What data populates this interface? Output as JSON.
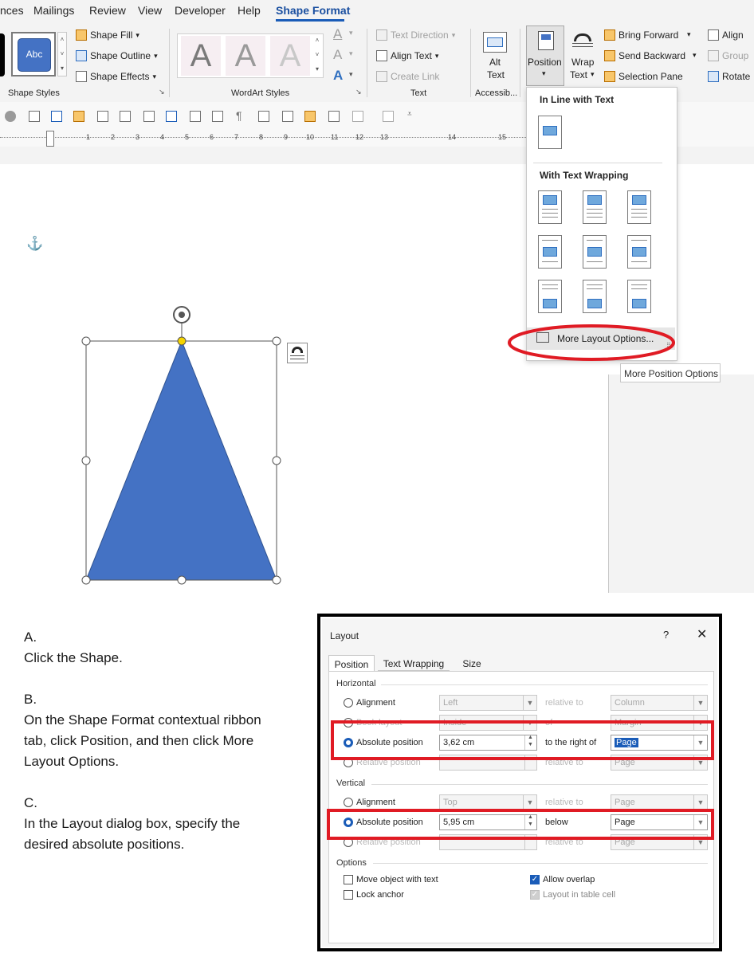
{
  "menu": {
    "items": [
      "nces",
      "Mailings",
      "Review",
      "View",
      "Developer",
      "Help",
      "Shape Format"
    ]
  },
  "ribbon": {
    "shape_styles": {
      "sample_label": "Abc",
      "shape_fill": "Shape Fill",
      "shape_outline": "Shape Outline",
      "shape_effects": "Shape Effects",
      "group_label": "Shape Styles"
    },
    "wordart": {
      "letter": "A",
      "group_label": "WordArt Styles"
    },
    "text": {
      "text_direction": "Text Direction",
      "align_text": "Align Text",
      "create_link": "Create Link",
      "group_label": "Text"
    },
    "accessibility": {
      "alt_text_line1": "Alt",
      "alt_text_line2": "Text",
      "group_label": "Accessib..."
    },
    "arrange": {
      "position": "Position",
      "wrap_line1": "Wrap",
      "wrap_line2": "Text",
      "bring_forward": "Bring Forward",
      "send_backward": "Send Backward",
      "selection_pane": "Selection Pane",
      "align": "Align",
      "group": "Group",
      "rotate": "Rotate"
    }
  },
  "ruler": {
    "numbers": [
      "1",
      "2",
      "3",
      "4",
      "5",
      "6",
      "7",
      "8",
      "9",
      "10",
      "11",
      "12",
      "13",
      "14",
      "15"
    ]
  },
  "position_menu": {
    "inline_heading": "In Line with Text",
    "wrapping_heading": "With Text Wrapping",
    "more_options": "More Layout Options...",
    "tooltip": "More Position Options"
  },
  "instructions": {
    "a_label": "A.",
    "a_text": "Click the Shape.",
    "b_label": "B.",
    "b_text": "On the Shape Format contextual ribbon tab, click Position, and then click More Layout Options.",
    "c_label": "C.",
    "c_text": "In the Layout dialog box, specify the desired absolute positions."
  },
  "dialog": {
    "title": "Layout",
    "help": "?",
    "close": "✕",
    "tabs": [
      "Position",
      "Text Wrapping",
      "Size"
    ],
    "horizontal": {
      "heading": "Horizontal",
      "alignment_label": "Alignment",
      "alignment_value": "Left",
      "alignment_rel_label": "relative to",
      "alignment_rel_value": "Column",
      "book_label": "Book layout",
      "book_value": "Inside",
      "book_rel_label": "of",
      "book_rel_value": "Margin",
      "absolute_label": "Absolute position",
      "absolute_value": "3,62 cm",
      "absolute_rel_label": "to the right of",
      "absolute_rel_value": "Page",
      "relative_label": "Relative position",
      "relative_rel_label": "relative to",
      "relative_rel_value": "Page"
    },
    "vertical": {
      "heading": "Vertical",
      "alignment_label": "Alignment",
      "alignment_value": "Top",
      "alignment_rel_label": "relative to",
      "alignment_rel_value": "Page",
      "absolute_label": "Absolute position",
      "absolute_value": "5,95 cm",
      "absolute_rel_label": "below",
      "absolute_rel_value": "Page",
      "relative_label": "Relative position",
      "relative_rel_label": "relative to",
      "relative_rel_value": "Page"
    },
    "options": {
      "heading": "Options",
      "move_with_text": "Move object with text",
      "lock_anchor": "Lock anchor",
      "allow_overlap": "Allow overlap",
      "layout_in_cell": "Layout in table cell"
    }
  },
  "colors": {
    "accent": "#1a5cb8",
    "shape_fill": "#4472c4",
    "highlight_red": "#e01b24"
  }
}
